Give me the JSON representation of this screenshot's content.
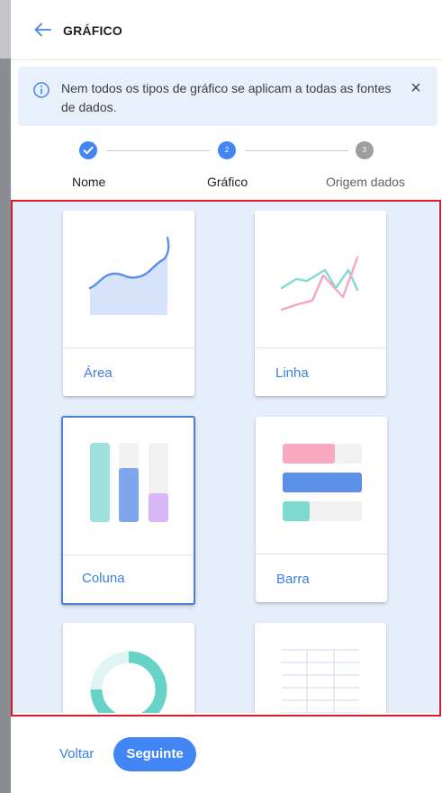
{
  "header": {
    "title": "GRÁFICO"
  },
  "banner": {
    "message": "Nem todos os tipos de gráfico se aplicam a todas as fontes de dados."
  },
  "stepper": {
    "steps": [
      {
        "label": "Nome",
        "state": "done"
      },
      {
        "label": "Gráfico",
        "number": "2",
        "state": "current"
      },
      {
        "label": "Origem dados",
        "number": "3",
        "state": "pending"
      }
    ]
  },
  "chart_types": [
    {
      "label": "Área",
      "icon": "area-chart-icon"
    },
    {
      "label": "Linha",
      "icon": "line-chart-icon"
    },
    {
      "label": "Coluna",
      "icon": "column-chart-icon",
      "selected": true
    },
    {
      "label": "Barra",
      "icon": "bar-chart-icon"
    },
    {
      "label": "",
      "icon": "donut-chart-icon"
    },
    {
      "label": "",
      "icon": "table-icon"
    }
  ],
  "footer": {
    "back_label": "Voltar",
    "next_label": "Seguinte"
  },
  "colors": {
    "accent": "#4285f4",
    "link": "#3d7fe0",
    "highlight_frame": "#e0192b",
    "grid_bg": "#e6eefb"
  }
}
